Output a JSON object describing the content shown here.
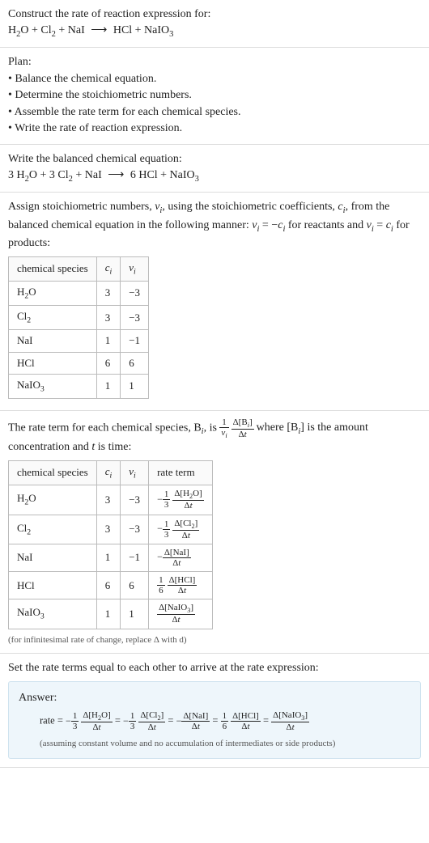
{
  "intro": {
    "prompt": "Construct the rate of reaction expression for:",
    "equation_html": "H<sub>2</sub>O + Cl<sub>2</sub> + NaI <span class='arrow'>⟶</span> HCl + NaIO<sub>3</sub>"
  },
  "plan": {
    "heading": "Plan:",
    "items": [
      "• Balance the chemical equation.",
      "• Determine the stoichiometric numbers.",
      "• Assemble the rate term for each chemical species.",
      "• Write the rate of reaction expression."
    ]
  },
  "balanced": {
    "heading": "Write the balanced chemical equation:",
    "equation_html": "3 H<sub>2</sub>O + 3 Cl<sub>2</sub> + NaI <span class='arrow'>⟶</span> 6 HCl + NaIO<sub>3</sub>"
  },
  "stoich": {
    "intro_html": "Assign stoichiometric numbers, <span class='italic'>ν<sub>i</sub></span>, using the stoichiometric coefficients, <span class='italic'>c<sub>i</sub></span>, from the balanced chemical equation in the following manner: <span class='italic'>ν<sub>i</sub></span> = −<span class='italic'>c<sub>i</sub></span> for reactants and <span class='italic'>ν<sub>i</sub></span> = <span class='italic'>c<sub>i</sub></span> for products:",
    "headers": {
      "sp": "chemical species",
      "c": "cᵢ",
      "v": "νᵢ"
    },
    "rows": [
      {
        "sp_html": "H<sub>2</sub>O",
        "c": "3",
        "v": "−3"
      },
      {
        "sp_html": "Cl<sub>2</sub>",
        "c": "3",
        "v": "−3"
      },
      {
        "sp_html": "NaI",
        "c": "1",
        "v": "−1"
      },
      {
        "sp_html": "HCl",
        "c": "6",
        "v": "6"
      },
      {
        "sp_html": "NaIO<sub>3</sub>",
        "c": "1",
        "v": "1"
      }
    ]
  },
  "rateterm": {
    "intro_pre": "The rate term for each chemical species, B",
    "intro_mid": ", is ",
    "intro_post_html": " where [B<sub><span class='italic'>i</span></sub>] is the amount concentration and <span class='italic'>t</span> is time:",
    "headers": {
      "sp": "chemical species",
      "c": "cᵢ",
      "v": "νᵢ",
      "rt": "rate term"
    },
    "rows": [
      {
        "sp_html": "H<sub>2</sub>O",
        "c": "3",
        "v": "−3",
        "neg": "−",
        "coef_num": "1",
        "coef_den": "3",
        "dnum_html": "Δ[H<sub>2</sub>O]",
        "dden_html": "Δ<span class='italic'>t</span>"
      },
      {
        "sp_html": "Cl<sub>2</sub>",
        "c": "3",
        "v": "−3",
        "neg": "−",
        "coef_num": "1",
        "coef_den": "3",
        "dnum_html": "Δ[Cl<sub>2</sub>]",
        "dden_html": "Δ<span class='italic'>t</span>"
      },
      {
        "sp_html": "NaI",
        "c": "1",
        "v": "−1",
        "neg": "−",
        "coef_num": "",
        "coef_den": "",
        "dnum_html": "Δ[NaI]",
        "dden_html": "Δ<span class='italic'>t</span>"
      },
      {
        "sp_html": "HCl",
        "c": "6",
        "v": "6",
        "neg": "",
        "coef_num": "1",
        "coef_den": "6",
        "dnum_html": "Δ[HCl]",
        "dden_html": "Δ<span class='italic'>t</span>"
      },
      {
        "sp_html": "NaIO<sub>3</sub>",
        "c": "1",
        "v": "1",
        "neg": "",
        "coef_num": "",
        "coef_den": "",
        "dnum_html": "Δ[NaIO<sub>3</sub>]",
        "dden_html": "Δ<span class='italic'>t</span>"
      }
    ],
    "footnote": "(for infinitesimal rate of change, replace Δ with d)"
  },
  "final": {
    "heading": "Set the rate terms equal to each other to arrive at the rate expression:"
  },
  "answer": {
    "label": "Answer:",
    "rate_label": "rate = ",
    "terms": [
      {
        "neg": "−",
        "coef_num": "1",
        "coef_den": "3",
        "dnum_html": "Δ[H<sub>2</sub>O]",
        "dden_html": "Δ<span class='italic'>t</span>"
      },
      {
        "neg": "−",
        "coef_num": "1",
        "coef_den": "3",
        "dnum_html": "Δ[Cl<sub>2</sub>]",
        "dden_html": "Δ<span class='italic'>t</span>"
      },
      {
        "neg": "−",
        "coef_num": "",
        "coef_den": "",
        "dnum_html": "Δ[NaI]",
        "dden_html": "Δ<span class='italic'>t</span>"
      },
      {
        "neg": "",
        "coef_num": "1",
        "coef_den": "6",
        "dnum_html": "Δ[HCl]",
        "dden_html": "Δ<span class='italic'>t</span>"
      },
      {
        "neg": "",
        "coef_num": "",
        "coef_den": "",
        "dnum_html": "Δ[NaIO<sub>3</sub>]",
        "dden_html": "Δ<span class='italic'>t</span>"
      }
    ],
    "note": "(assuming constant volume and no accumulation of intermediates or side products)"
  },
  "chart_data": {
    "type": "table",
    "tables": [
      {
        "title": "Stoichiometric numbers",
        "columns": [
          "chemical species",
          "cᵢ",
          "νᵢ"
        ],
        "rows": [
          [
            "H2O",
            3,
            -3
          ],
          [
            "Cl2",
            3,
            -3
          ],
          [
            "NaI",
            1,
            -1
          ],
          [
            "HCl",
            6,
            6
          ],
          [
            "NaIO3",
            1,
            1
          ]
        ]
      },
      {
        "title": "Rate terms",
        "columns": [
          "chemical species",
          "cᵢ",
          "νᵢ",
          "rate term"
        ],
        "rows": [
          [
            "H2O",
            3,
            -3,
            "-(1/3) Δ[H2O]/Δt"
          ],
          [
            "Cl2",
            3,
            -3,
            "-(1/3) Δ[Cl2]/Δt"
          ],
          [
            "NaI",
            1,
            -1,
            "- Δ[NaI]/Δt"
          ],
          [
            "HCl",
            6,
            6,
            "(1/6) Δ[HCl]/Δt"
          ],
          [
            "NaIO3",
            1,
            1,
            "Δ[NaIO3]/Δt"
          ]
        ]
      }
    ]
  }
}
